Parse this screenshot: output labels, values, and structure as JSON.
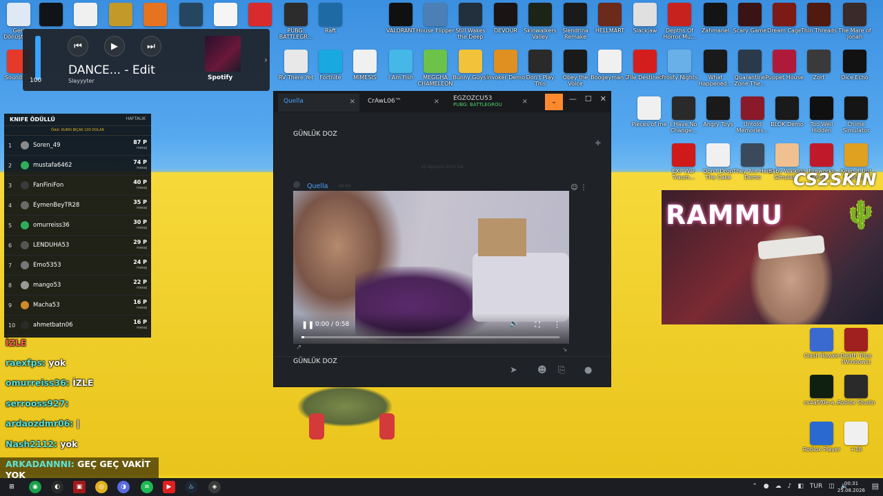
{
  "desktop": {
    "icons": [
      {
        "label": "Geri Dönüştür...",
        "color": "#dfe9f5"
      },
      {
        "label": "",
        "color": "#101418"
      },
      {
        "label": "",
        "color": "#f0f0f0"
      },
      {
        "label": "",
        "color": "#c39a2a"
      },
      {
        "label": "",
        "color": "#e5731f"
      },
      {
        "label": "",
        "color": "#25465e"
      },
      {
        "label": "",
        "color": "#f5f5f5"
      },
      {
        "label": "",
        "color": "#d82b2b"
      },
      {
        "label": "PUBG: BATTLEGR...",
        "color": "#2c2c2c"
      },
      {
        "label": "Raft",
        "color": "#1e6aa5"
      },
      {
        "label": "VALORANT",
        "color": "#101010"
      },
      {
        "label": "House Flipper",
        "color": "#4b7fb5"
      },
      {
        "label": "Still Wakes the Deep",
        "color": "#22303e"
      },
      {
        "label": "DEVOUR",
        "color": "#1a1414"
      },
      {
        "label": "Skinwalkers Valley",
        "color": "#1c2418"
      },
      {
        "label": "Slendrina Remake",
        "color": "#1a1a1a"
      },
      {
        "label": "HELLMART",
        "color": "#6b2a1a"
      },
      {
        "label": "Slackjaw",
        "color": "#e0e0e0"
      },
      {
        "label": "Depths Of Horror Mu...",
        "color": "#c8221e"
      },
      {
        "label": "Zahmanel",
        "color": "#141414"
      },
      {
        "label": "Scary Game",
        "color": "#3a1414"
      },
      {
        "label": "Dream Cage",
        "color": "#7c1a16"
      },
      {
        "label": "Thin Threads",
        "color": "#501a10"
      },
      {
        "label": "The Mare of Jonah",
        "color": "#3a2a2a"
      },
      {
        "label": "Soundpad",
        "color": "#e53a2a"
      },
      {
        "label": "RV There Yet",
        "color": "#e8e8e8"
      },
      {
        "label": "Fortnite",
        "color": "#1aa8e0"
      },
      {
        "label": "MIMESIS",
        "color": "#f0f0f0"
      },
      {
        "label": "I Am Fish",
        "color": "#45b8e8"
      },
      {
        "label": "MEGGHA CHAMELEON",
        "color": "#6dc24a"
      },
      {
        "label": "Bunny Guys!",
        "color": "#f2c33a"
      },
      {
        "label": "Invoker Demo",
        "color": "#e09020"
      },
      {
        "label": "Don't Play This",
        "color": "#2a2a2a"
      },
      {
        "label": "Obey the Voice",
        "color": "#1a1a1a"
      },
      {
        "label": "Boogeyman 2",
        "color": "#f0f0f0"
      },
      {
        "label": "File Destined",
        "color": "#d41e1e"
      },
      {
        "label": "Frosty Nights",
        "color": "#6ab0e8"
      },
      {
        "label": "What Happened...",
        "color": "#1a1a1a"
      },
      {
        "label": "Quarantine Zone The...",
        "color": "#2a3a4a"
      },
      {
        "label": "Puppet House",
        "color": "#b01a3a"
      },
      {
        "label": "Zort",
        "color": "#3a3a3a"
      },
      {
        "label": "Dice Echo",
        "color": "#121212"
      }
    ],
    "right_icons": [
      {
        "label": "Pieces of me",
        "color": "#f0f0f0"
      },
      {
        "label": "I Have No Change...",
        "color": "#2a2a2a"
      },
      {
        "label": "Angry Toys",
        "color": "#1a1a1a"
      },
      {
        "label": "Untold Memories...",
        "color": "#8a1a2a"
      },
      {
        "label": "BLOK Demo",
        "color": "#1a1a1a"
      },
      {
        "label": "Too Well Hidden",
        "color": "#101010"
      },
      {
        "label": "Chime Simulator",
        "color": "#151515"
      },
      {
        "label": "EXP War Traum...",
        "color": "#d01a1a"
      },
      {
        "label": "Don't Drop The Cake",
        "color": "#f0f0f0"
      },
      {
        "label": "They Are Here Demo",
        "color": "#3a4a5a"
      },
      {
        "label": "Baby Walking Simulat...",
        "color": "#f0c090"
      },
      {
        "label": "Fireworks Simulat...",
        "color": "#c01a2a"
      },
      {
        "label": "Keep It Up! Keep It...",
        "color": "#e0a020"
      },
      {
        "label": "Clash Royale",
        "color": "#3a6ad0"
      },
      {
        "label": "Death Trips (Windows)",
        "color": "#a02020"
      },
      {
        "label": "cs4a5f0e-a...",
        "color": "#102010"
      },
      {
        "label": "Roblox Studio",
        "color": "#2a2a2a"
      },
      {
        "label": "Roblox Player",
        "color": "#2a6ad0"
      },
      {
        "label": "+18",
        "color": "#f0f0f0"
      }
    ]
  },
  "media": {
    "title": "DANCE... - Edit",
    "artist": "Slayyyter",
    "volume": 100,
    "volume_text": "100",
    "prev": "⏮",
    "play": "▶",
    "next": "⏭",
    "service": "Spotify",
    "arrow": "›"
  },
  "leaderboard": {
    "title": "KNIFE ÖDÜLLÜ",
    "period": "HAFTALIK",
    "prize": "Ödül: KUKRI BIÇAK 100 DOLAR",
    "rows": [
      {
        "rank": "1",
        "name": "Soren_49",
        "points": "87 P",
        "sub": "mesaj"
      },
      {
        "rank": "2",
        "name": "mustafa6462",
        "points": "74 P",
        "sub": "mesaj"
      },
      {
        "rank": "3",
        "name": "FanFiniFon",
        "points": "40 P",
        "sub": "mesaj"
      },
      {
        "rank": "4",
        "name": "EymenBeyTR28",
        "points": "35 P",
        "sub": "mesaj"
      },
      {
        "rank": "5",
        "name": "omurreiss36",
        "points": "30 P",
        "sub": "mesaj"
      },
      {
        "rank": "6",
        "name": "LENDUHA53",
        "points": "29 P",
        "sub": "mesaj"
      },
      {
        "rank": "7",
        "name": "Emo5353",
        "points": "24 P",
        "sub": "mesaj"
      },
      {
        "rank": "8",
        "name": "mango53",
        "points": "22 P",
        "sub": "mesaj"
      },
      {
        "rank": "9",
        "name": "Macha53",
        "points": "16 P",
        "sub": "mesaj"
      },
      {
        "rank": "10",
        "name": "ahmetbatn06",
        "points": "16 P",
        "sub": "mesaj"
      }
    ]
  },
  "chat": [
    {
      "user": "raexfps:",
      "text": " yok"
    },
    {
      "user": "omurreiss36:",
      "text": " İZLE"
    },
    {
      "user": "serrooss927:",
      "text": ""
    },
    {
      "user": "ardaozdmr06:",
      "text": " |"
    },
    {
      "user": "Nash2112:",
      "text": " yok"
    }
  ],
  "chat_big": {
    "user": "ARKADANNNI:",
    "text": " GEÇ GEÇ VAKİT YOK"
  },
  "chat_partial": "İZLE",
  "discord": {
    "tabs": [
      {
        "label": "Quella",
        "active": true
      },
      {
        "label": "CrAwL06™",
        "active": false
      },
      {
        "label": "EGZOZCU53",
        "sub": "PUBG: BATTLEGROU",
        "active": false
      }
    ],
    "dropdown": "⌄",
    "msg_top": "GÜNLÜK DOZ",
    "date": "25 Ağustos 2026 Sal",
    "author": "Quella",
    "time": "00:04",
    "video_time": "0:00 / 0:58",
    "video_progress": 0.0,
    "msg_bottom": "GÜNLÜK DOZ"
  },
  "webcam": {
    "sign": "RAMMU",
    "logo": "CS2SKIN"
  },
  "taskbar": {
    "lang": "TUR",
    "time": "00:31",
    "date": "25.08.2026"
  }
}
